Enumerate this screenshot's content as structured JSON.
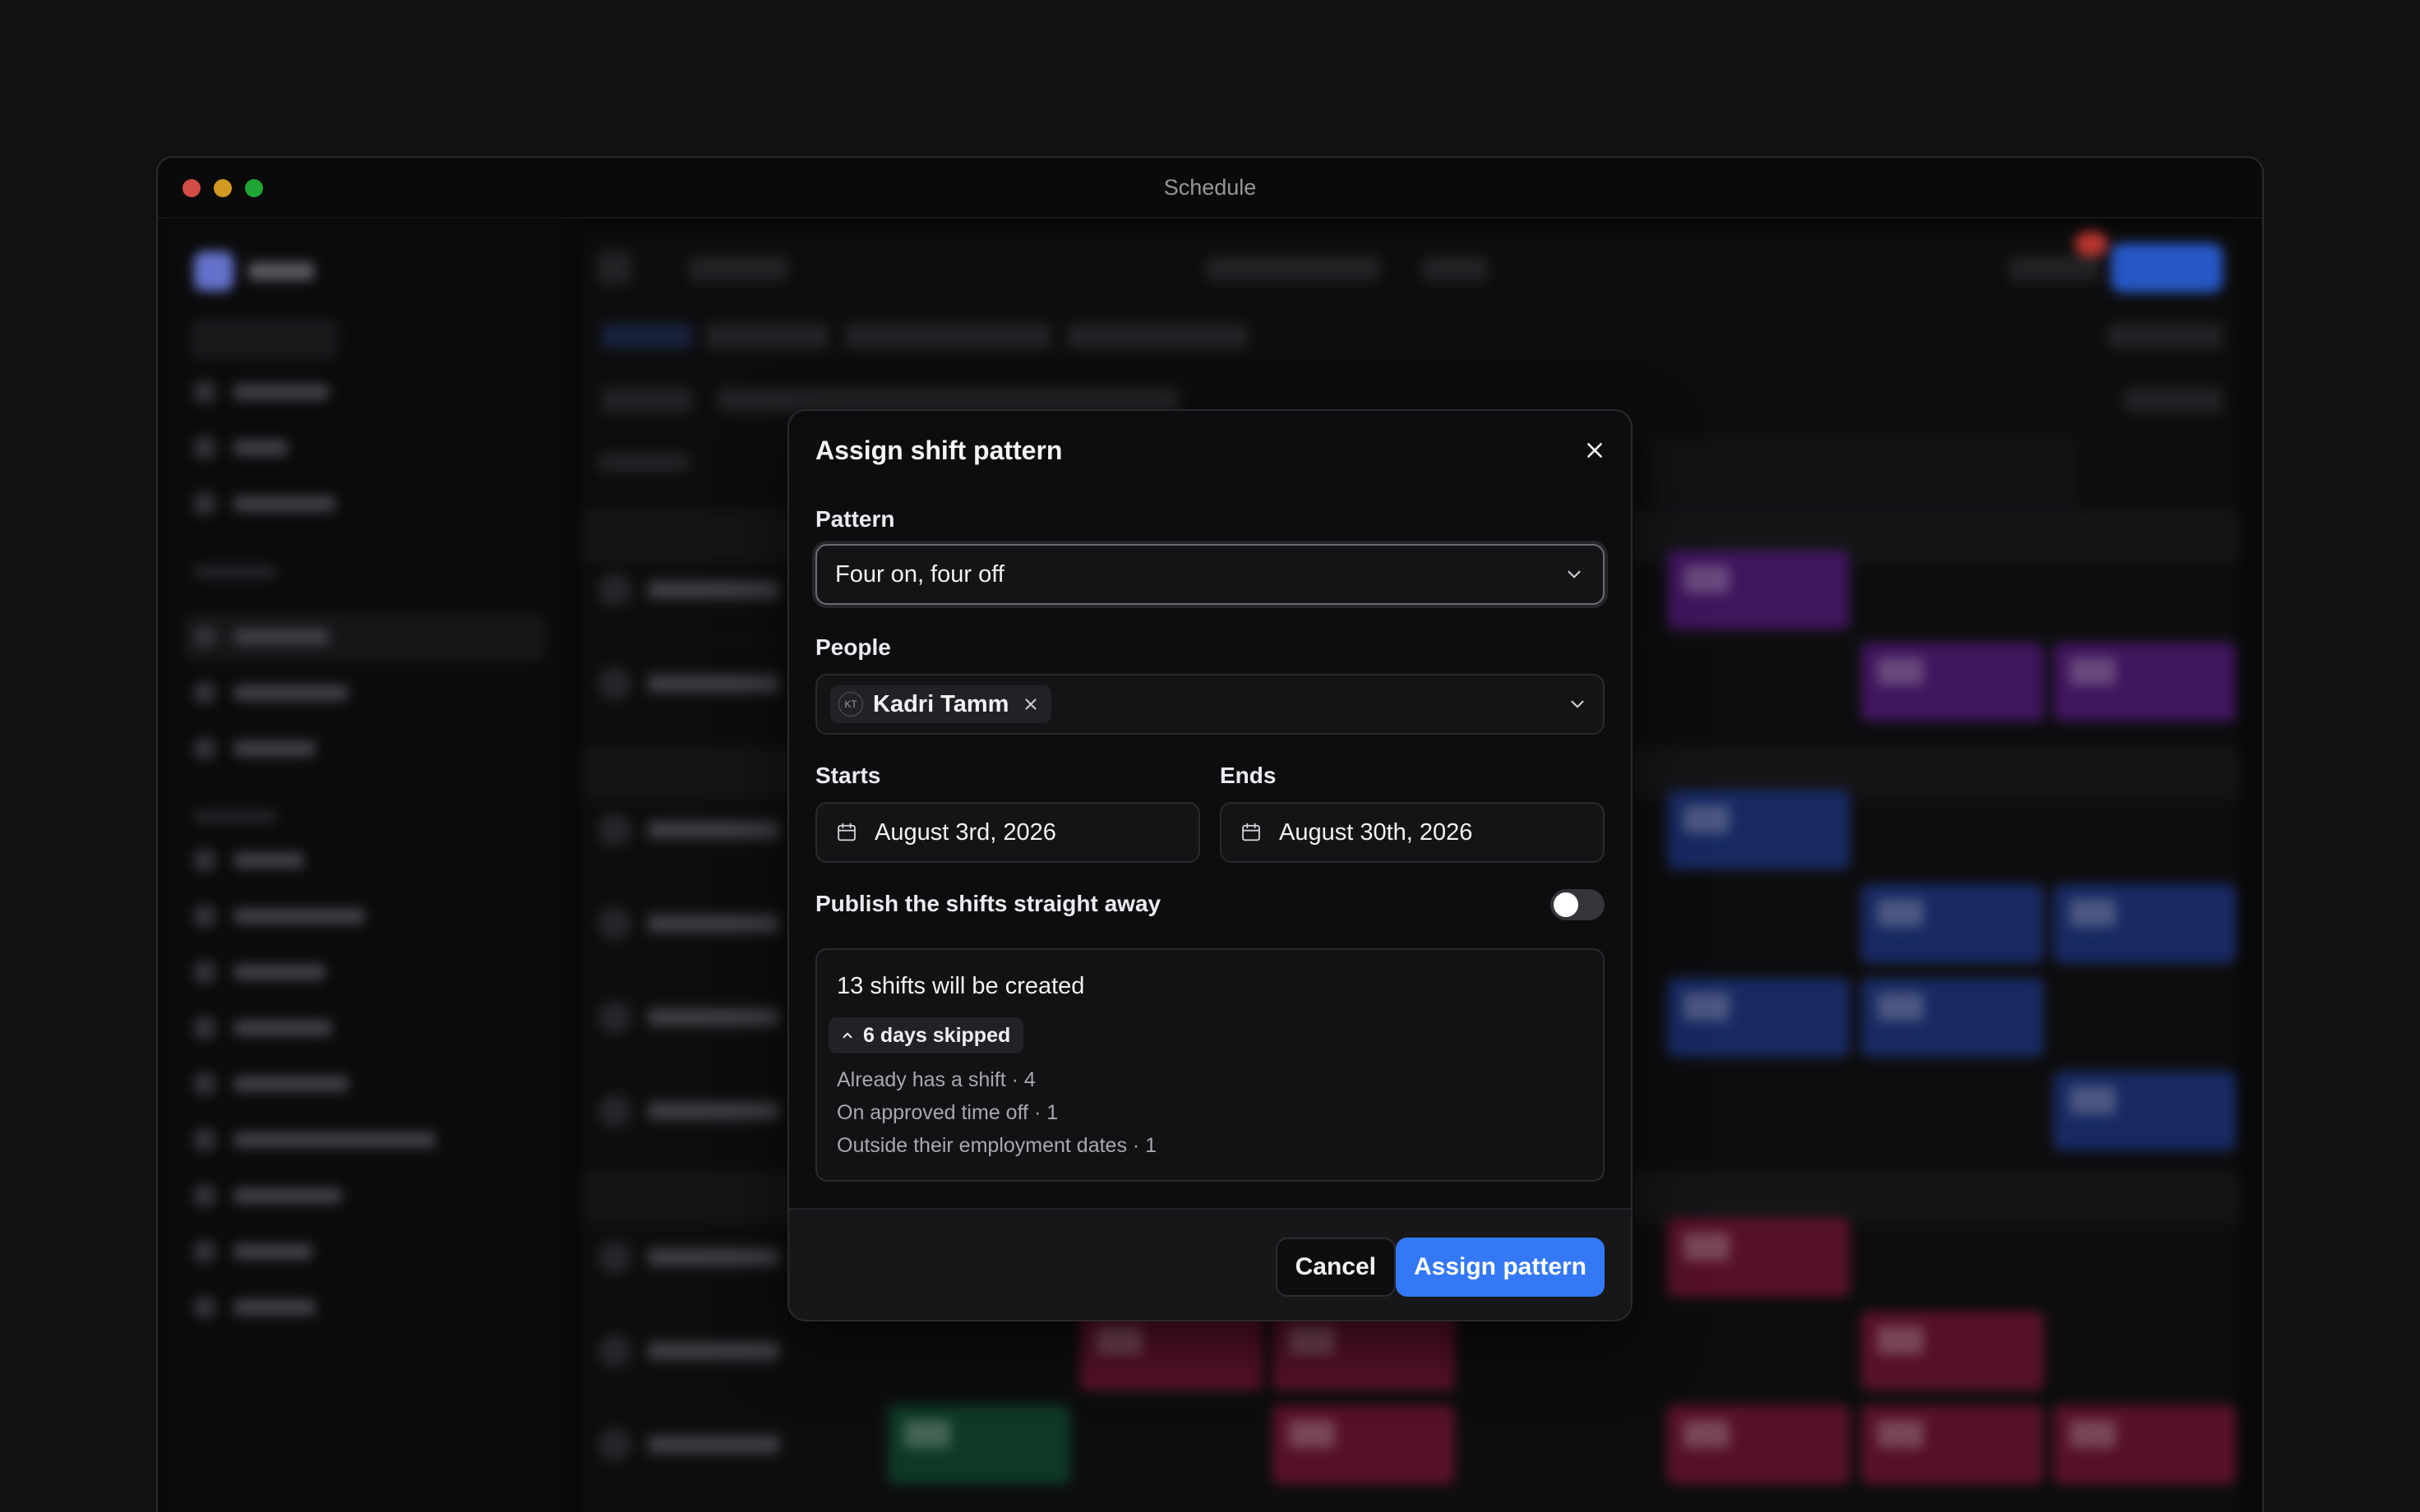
{
  "window": {
    "title": "Schedule"
  },
  "modal": {
    "title": "Assign shift pattern",
    "pattern": {
      "label": "Pattern",
      "value": "Four on, four off"
    },
    "people": {
      "label": "People",
      "selected": [
        {
          "initials": "KT",
          "name": "Kadri Tamm"
        }
      ]
    },
    "starts": {
      "label": "Starts",
      "value": "August 3rd, 2026"
    },
    "ends": {
      "label": "Ends",
      "value": "August 30th, 2026"
    },
    "publish": {
      "label": "Publish the shifts straight away",
      "enabled": false
    },
    "summary": {
      "title": "13 shifts will be created",
      "skipped_label": "6 days skipped",
      "reasons": [
        "Already has a shift · 4",
        "On approved time off · 1",
        "Outside their employment dates · 1"
      ]
    },
    "cancel_label": "Cancel",
    "assign_label": "Assign pattern"
  },
  "colors": {
    "accent": "#3478f6",
    "background": "#111113",
    "modal": "#0d0d0f",
    "shift_purple": "#4e1a72",
    "shift_blue": "#1e3378",
    "shift_red": "#6a1532",
    "shift_green": "#12462f"
  }
}
